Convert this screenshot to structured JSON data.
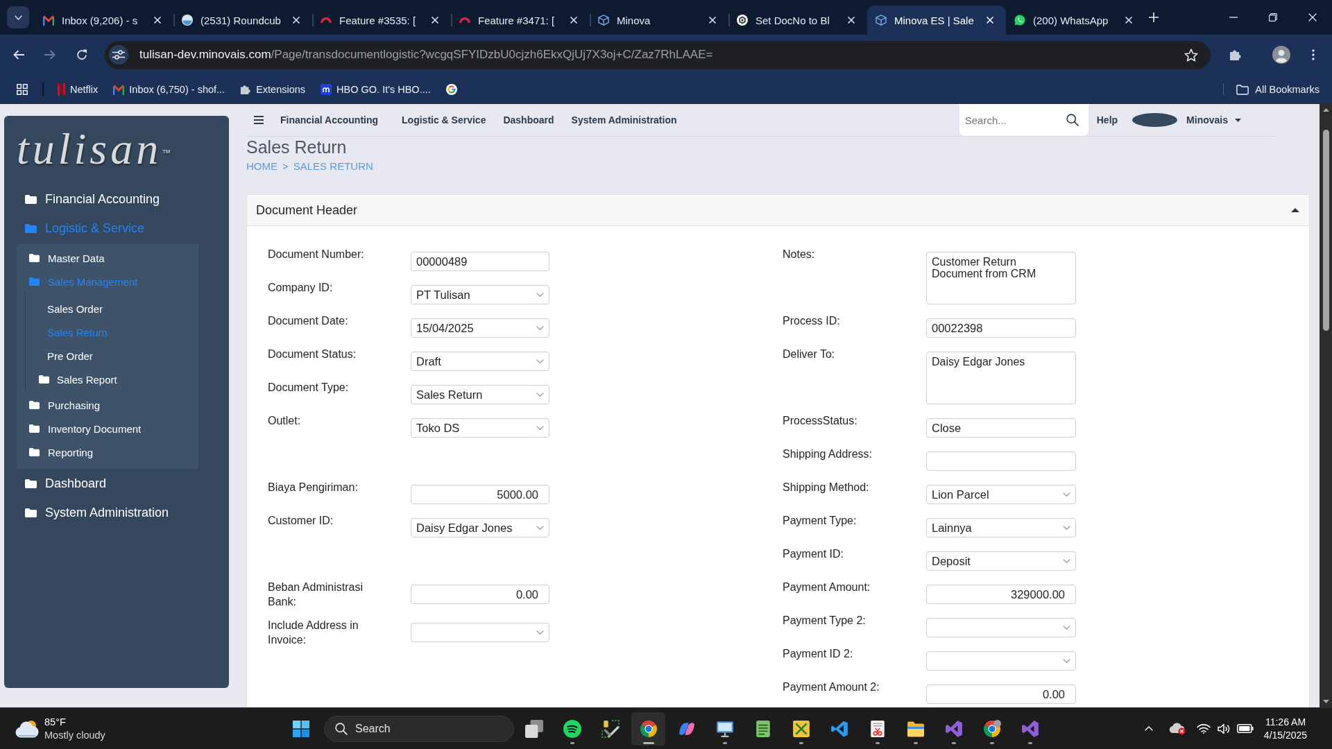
{
  "browser": {
    "tabs": [
      {
        "kind": "mail",
        "title": "Inbox (9,206) - s",
        "selected": false
      },
      {
        "kind": "sphere",
        "title": "(2531) Roundcub",
        "selected": false
      },
      {
        "kind": "arc",
        "title": "Feature #3535: [",
        "selected": false
      },
      {
        "kind": "arc",
        "title": "Feature #3471: [",
        "selected": false
      },
      {
        "kind": "cube",
        "title": "Minova",
        "selected": false
      },
      {
        "kind": "knot",
        "title": "Set DocNo to Bl",
        "selected": false
      },
      {
        "kind": "cube",
        "title": "Minova ES | Sale",
        "selected": true
      },
      {
        "kind": "chat",
        "title": "(200) WhatsApp",
        "selected": false
      }
    ],
    "address": {
      "host": "tulisan-dev.minovais.com",
      "path": "/Page/transdocumentlogistic?wcgqSFYIDzbU0cjzh6EkxQjUj7X3oj+C/Zaz7RhLAAE="
    },
    "bookmarks": [
      {
        "kind": "n-logo",
        "label": "Netflix"
      },
      {
        "kind": "mail",
        "label": "Inbox (6,750) - shof..."
      },
      {
        "kind": "puzzle",
        "label": "Extensions"
      },
      {
        "kind": "square-logo",
        "label": "HBO GO. It's HBO...."
      },
      {
        "kind": "ring-logo"
      }
    ],
    "all_bookmarks": "All Bookmarks"
  },
  "sidebar": {
    "logo": {
      "text": "tulisan",
      "mark": "™"
    },
    "items": [
      {
        "label": "Financial Accounting",
        "selected": false
      },
      {
        "label": "Logistic & Service",
        "selected": true,
        "children": [
          {
            "label": "Master Data",
            "selected": false
          },
          {
            "label": "Sales Management",
            "selected": true,
            "children": [
              {
                "kind": "link",
                "label": "Sales Order",
                "selected": false
              },
              {
                "kind": "link",
                "label": "Sales Return",
                "selected": true
              },
              {
                "kind": "link",
                "label": "Pre Order",
                "selected": false
              },
              {
                "kind": "folder",
                "label": "Sales Report",
                "selected": false
              }
            ]
          },
          {
            "label": "Purchasing",
            "selected": false
          },
          {
            "label": "Inventory Document",
            "selected": false
          },
          {
            "label": "Reporting",
            "selected": false
          }
        ]
      },
      {
        "label": "Dashboard",
        "selected": false
      },
      {
        "label": "System Administration",
        "selected": false
      }
    ]
  },
  "topnav": {
    "menu": [
      "Financial Accounting",
      "Logistic & Service",
      "Dashboard",
      "System Administration"
    ],
    "search": {
      "placeholder": "Search..."
    },
    "help": "Help",
    "user": "Minovais"
  },
  "page": {
    "title": "Sales Return",
    "breadcrumb": {
      "items": [
        "HOME",
        "SALES RETURN"
      ],
      "separator": ">"
    }
  },
  "panel": {
    "title": "Document Header",
    "left_fields": [
      {
        "kind": "text",
        "label": "Document Number:",
        "value": "00000489"
      },
      {
        "kind": "select",
        "label": "Company ID:",
        "value": "PT Tulisan"
      },
      {
        "kind": "select",
        "label": "Document Date:",
        "value": "15/04/2025"
      },
      {
        "kind": "select",
        "label": "Document Status:",
        "value": "Draft"
      },
      {
        "kind": "select",
        "label": "Document Type:",
        "value": "Sales Return"
      },
      {
        "kind": "select",
        "label": "Outlet:",
        "value": "Toko DS"
      },
      {
        "kind": "number",
        "label": "Biaya Pengiriman:",
        "value": "5000.00"
      },
      {
        "kind": "select",
        "label": "Customer ID:",
        "value": "Daisy Edgar Jones"
      },
      {
        "kind": "number",
        "label": "Beban Administrasi Bank:",
        "value": "0.00"
      },
      {
        "kind": "select",
        "label": "Include Address in Invoice:"
      }
    ],
    "right_fields": [
      {
        "kind": "textarea",
        "label": "Notes:",
        "value": "Customer Return Document from CRM"
      },
      {
        "kind": "text",
        "label": "Process ID:",
        "value": "00022398"
      },
      {
        "kind": "textarea",
        "label": "Deliver To:",
        "value": "Daisy Edgar Jones"
      },
      {
        "kind": "text",
        "label": "ProcessStatus:",
        "value": "Close"
      },
      {
        "kind": "text",
        "label": "Shipping Address:"
      },
      {
        "kind": "select",
        "label": "Shipping Method:",
        "value": "Lion Parcel"
      },
      {
        "kind": "select",
        "label": "Payment Type:",
        "value": "Lainnya"
      },
      {
        "kind": "select",
        "label": "Payment ID:",
        "value": "Deposit"
      },
      {
        "kind": "number",
        "label": "Payment Amount:",
        "value": "329000.00"
      },
      {
        "kind": "select",
        "label": "Payment Type 2:"
      },
      {
        "kind": "select",
        "label": "Payment ID 2:"
      },
      {
        "kind": "number",
        "label": "Payment Amount 2:",
        "value": "0.00"
      }
    ]
  },
  "taskbar": {
    "weather": {
      "temperature": "85°F",
      "condition": "Mostly cloudy"
    },
    "search": {
      "label": "Search"
    },
    "apps": [
      {
        "kind": "task-view",
        "running": false,
        "selected": false
      },
      {
        "kind": "music",
        "running": true,
        "selected": false
      },
      {
        "kind": "tools",
        "running": false,
        "selected": false
      },
      {
        "kind": "browser",
        "running": true,
        "selected": true
      },
      {
        "kind": "assistant",
        "running": false,
        "selected": false
      },
      {
        "kind": "remote",
        "running": true,
        "selected": false
      },
      {
        "kind": "notepad",
        "running": false,
        "selected": false
      },
      {
        "kind": "crossed-tools",
        "running": true,
        "selected": false
      },
      {
        "kind": "code",
        "running": false,
        "selected": false
      },
      {
        "kind": "snip",
        "running": true,
        "selected": false
      },
      {
        "kind": "files",
        "running": true,
        "selected": false
      },
      {
        "kind": "ide",
        "running": true,
        "selected": false
      },
      {
        "kind": "browser-alt",
        "running": true,
        "selected": false
      },
      {
        "kind": "ide",
        "running": true,
        "selected": false
      }
    ],
    "clock": {
      "time": "11:26 AM",
      "date": "4/15/2025"
    }
  }
}
